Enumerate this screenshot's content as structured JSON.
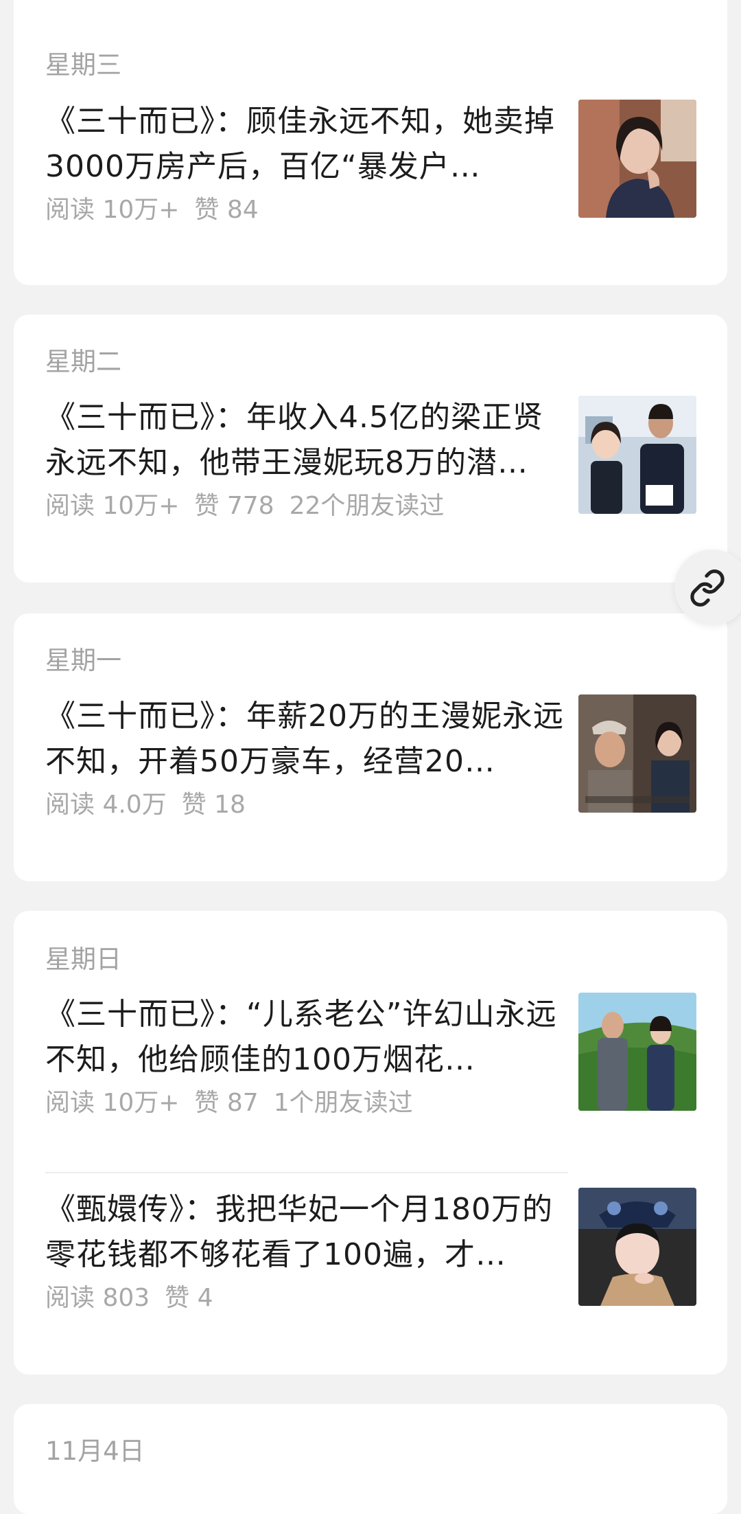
{
  "groups": [
    {
      "day": "星期三",
      "articles": [
        {
          "title": "《三十而已》：顾佳永远不知，她卖掉3000万房产后，百亿“暴发户…",
          "reads": "阅读 10万+",
          "likes": "赞 84",
          "friends": ""
        }
      ]
    },
    {
      "day": "星期二",
      "articles": [
        {
          "title": "《三十而已》：年收入4.5亿的梁正贤永远不知，他带王漫妮玩8万的潜…",
          "reads": "阅读 10万+",
          "likes": "赞 778",
          "friends": "22个朋友读过"
        }
      ]
    },
    {
      "day": "星期一",
      "articles": [
        {
          "title": "《三十而已》：年薪20万的王漫妮永远不知，开着50万豪车，经营20…",
          "reads": "阅读 4.0万",
          "likes": "赞 18",
          "friends": ""
        }
      ]
    },
    {
      "day": "星期日",
      "articles": [
        {
          "title": "《三十而已》：“儿系老公”许幻山永远不知，他给顾佳的100万烟花…",
          "reads": "阅读 10万+",
          "likes": "赞 87",
          "friends": "1个朋友读过"
        },
        {
          "title": "《甄嬛传》：我把华妃一个月180万的零花钱都不够花看了100遍，才…",
          "reads": "阅读 803",
          "likes": "赞 4",
          "friends": ""
        }
      ]
    },
    {
      "day": "11月4日",
      "articles": []
    }
  ],
  "floating": {
    "icon": "link-icon"
  },
  "colors": {
    "background": "#f2f2f2",
    "card": "#ffffff",
    "title": "#1c1c1c",
    "meta": "#a8a8a8"
  }
}
